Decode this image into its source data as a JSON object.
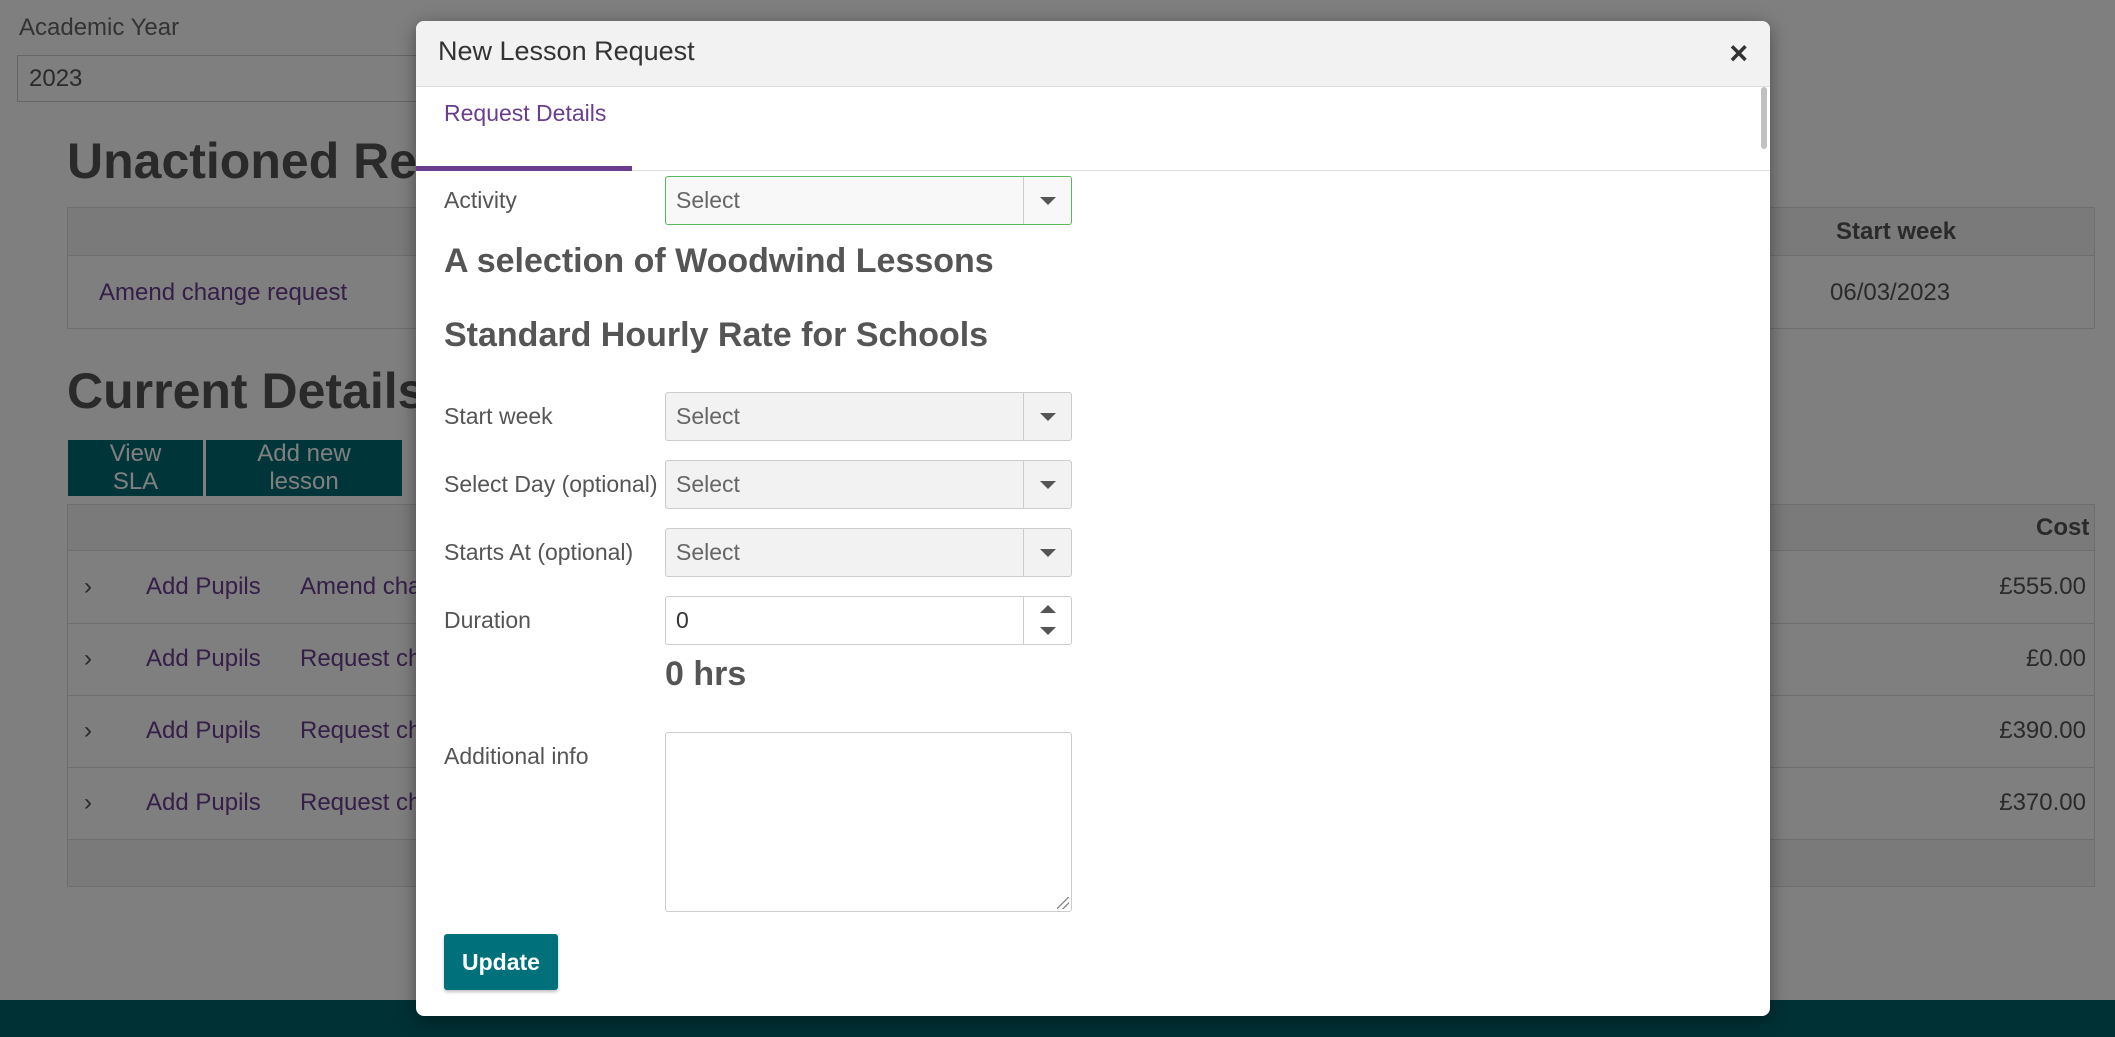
{
  "background": {
    "academic_year_label": "Academic Year",
    "academic_year_value": "2023",
    "unactioned_title": "Unactioned Requ",
    "unactioned_table": {
      "header_start_week": "Start week",
      "row": {
        "link": "Amend change request",
        "start_week": "06/03/2023"
      }
    },
    "current_details_title": "Current Details",
    "buttons": {
      "view_sla": "View SLA",
      "add_new_lesson": "Add new lesson"
    },
    "current_table": {
      "header_cost": "Cost",
      "rows": [
        {
          "action": "Add Pupils",
          "type": "Amend char",
          "cost": "£555.00"
        },
        {
          "action": "Add Pupils",
          "type": "Request cha",
          "cost": "£0.00"
        },
        {
          "action": "Add Pupils",
          "type": "Request cha",
          "cost": "£390.00"
        },
        {
          "action": "Add Pupils",
          "type": "Request cha",
          "cost": "£370.00"
        }
      ]
    }
  },
  "modal": {
    "title": "New Lesson Request",
    "close_symbol": "×",
    "tab_label": "Request Details",
    "activity": {
      "label": "Activity",
      "value": "Select"
    },
    "activity_heading": "A selection of Woodwind Lessons",
    "rate_heading": "Standard Hourly Rate for Schools",
    "start_week": {
      "label": "Start week",
      "value": "Select"
    },
    "select_day": {
      "label": "Select Day (optional)",
      "value": "Select"
    },
    "starts_at": {
      "label": "Starts At (optional)",
      "value": "Select"
    },
    "duration": {
      "label": "Duration",
      "value": "0"
    },
    "duration_display": "0 hrs",
    "additional_info": {
      "label": "Additional info",
      "value": ""
    },
    "update_button": "Update"
  },
  "colors": {
    "accent": "#6a3d8f",
    "primary": "#006d75",
    "active_border": "#5cb85c"
  }
}
